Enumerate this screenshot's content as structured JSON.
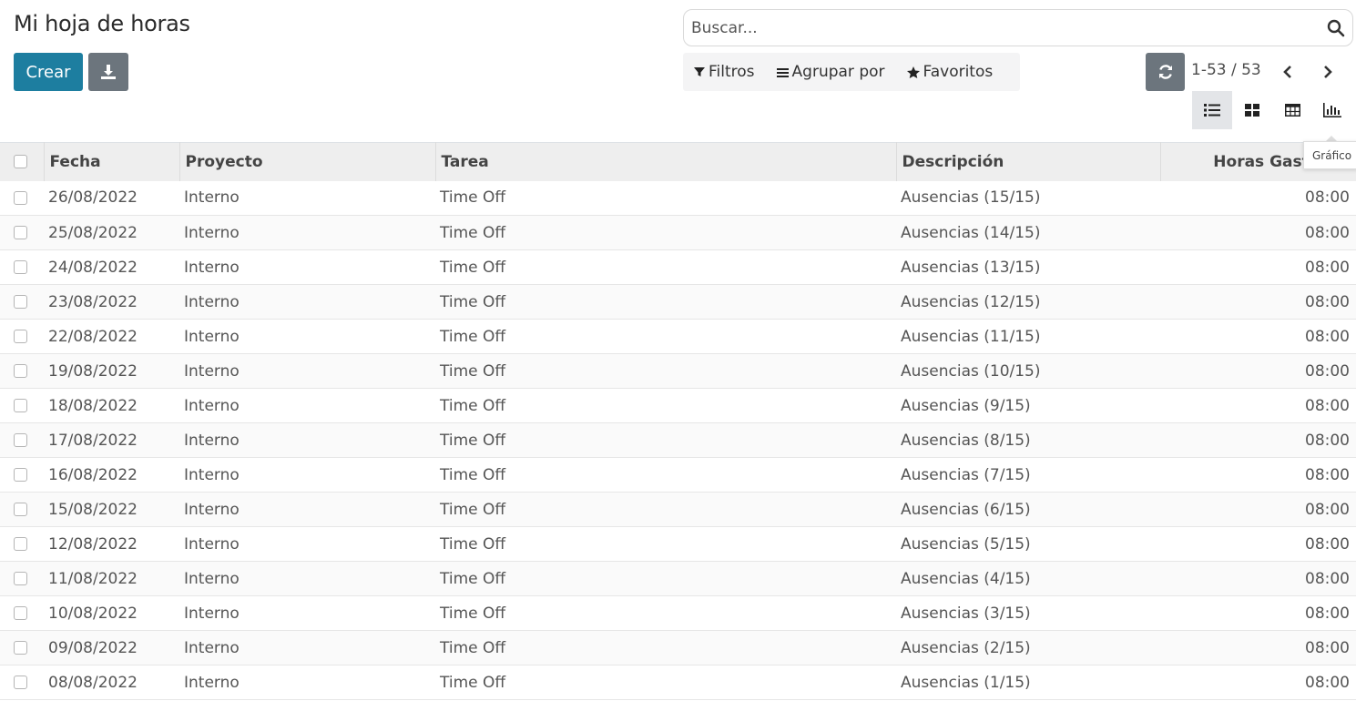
{
  "page": {
    "title": "Mi hoja de horas"
  },
  "toolbar": {
    "create_label": "Crear",
    "download_icon": "download-icon"
  },
  "search": {
    "placeholder": "Buscar..."
  },
  "filters": {
    "filters_label": "Filtros",
    "group_label": "Agrupar por",
    "favorites_label": "Favoritos"
  },
  "pager": {
    "value": "1-53 / 53"
  },
  "views": [
    "list",
    "kanban",
    "grid",
    "graph"
  ],
  "tooltip": {
    "text": "Gráfico"
  },
  "colors": {
    "primary": "#1d7ea0",
    "secondary": "#6c757d"
  },
  "table": {
    "columns": [
      "Fecha",
      "Proyecto",
      "Tarea",
      "Descripción",
      "Horas Gastadas"
    ],
    "rows": [
      {
        "fecha": "26/08/2022",
        "proyecto": "Interno",
        "tarea": "Time Off",
        "descripcion": "Ausencias (15/15)",
        "horas": "08:00"
      },
      {
        "fecha": "25/08/2022",
        "proyecto": "Interno",
        "tarea": "Time Off",
        "descripcion": "Ausencias (14/15)",
        "horas": "08:00"
      },
      {
        "fecha": "24/08/2022",
        "proyecto": "Interno",
        "tarea": "Time Off",
        "descripcion": "Ausencias (13/15)",
        "horas": "08:00"
      },
      {
        "fecha": "23/08/2022",
        "proyecto": "Interno",
        "tarea": "Time Off",
        "descripcion": "Ausencias (12/15)",
        "horas": "08:00"
      },
      {
        "fecha": "22/08/2022",
        "proyecto": "Interno",
        "tarea": "Time Off",
        "descripcion": "Ausencias (11/15)",
        "horas": "08:00"
      },
      {
        "fecha": "19/08/2022",
        "proyecto": "Interno",
        "tarea": "Time Off",
        "descripcion": "Ausencias (10/15)",
        "horas": "08:00"
      },
      {
        "fecha": "18/08/2022",
        "proyecto": "Interno",
        "tarea": "Time Off",
        "descripcion": "Ausencias (9/15)",
        "horas": "08:00"
      },
      {
        "fecha": "17/08/2022",
        "proyecto": "Interno",
        "tarea": "Time Off",
        "descripcion": "Ausencias (8/15)",
        "horas": "08:00"
      },
      {
        "fecha": "16/08/2022",
        "proyecto": "Interno",
        "tarea": "Time Off",
        "descripcion": "Ausencias (7/15)",
        "horas": "08:00"
      },
      {
        "fecha": "15/08/2022",
        "proyecto": "Interno",
        "tarea": "Time Off",
        "descripcion": "Ausencias (6/15)",
        "horas": "08:00"
      },
      {
        "fecha": "12/08/2022",
        "proyecto": "Interno",
        "tarea": "Time Off",
        "descripcion": "Ausencias (5/15)",
        "horas": "08:00"
      },
      {
        "fecha": "11/08/2022",
        "proyecto": "Interno",
        "tarea": "Time Off",
        "descripcion": "Ausencias (4/15)",
        "horas": "08:00"
      },
      {
        "fecha": "10/08/2022",
        "proyecto": "Interno",
        "tarea": "Time Off",
        "descripcion": "Ausencias (3/15)",
        "horas": "08:00"
      },
      {
        "fecha": "09/08/2022",
        "proyecto": "Interno",
        "tarea": "Time Off",
        "descripcion": "Ausencias (2/15)",
        "horas": "08:00"
      },
      {
        "fecha": "08/08/2022",
        "proyecto": "Interno",
        "tarea": "Time Off",
        "descripcion": "Ausencias (1/15)",
        "horas": "08:00"
      }
    ]
  }
}
